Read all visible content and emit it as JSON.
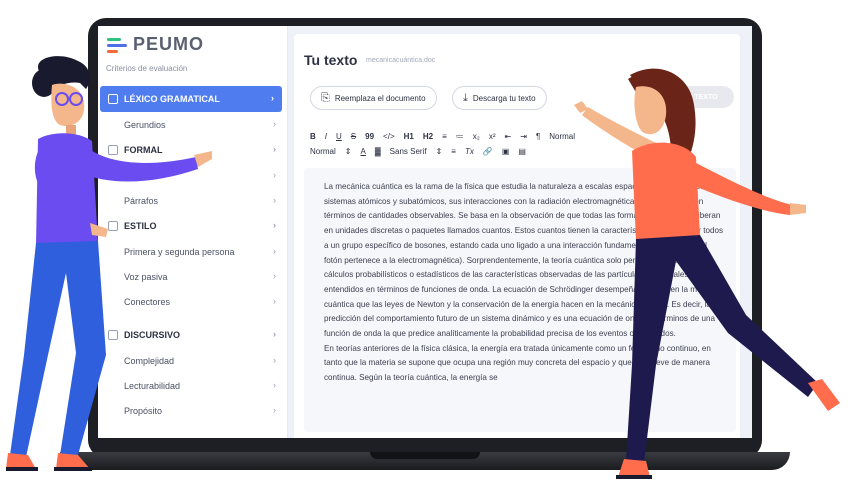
{
  "brand": {
    "name": "PEUMO"
  },
  "sidebar": {
    "header": "Criterios de evaluación",
    "sections": [
      {
        "label": "LÉXICO GRAMATICAL",
        "active": true
      },
      {
        "label": "FORMAL"
      },
      {
        "label": "ESTILO"
      },
      {
        "label": "DISCURSIVO"
      }
    ],
    "sub_lexico": [
      "Gerundios"
    ],
    "sub_formal": [
      "Párrafos"
    ],
    "sub_estilo": [
      "Primera y segunda persona",
      "Voz pasiva",
      "Conectores"
    ],
    "sub_discursivo": [
      "Complejidad",
      "Lecturabilidad",
      "Propósito"
    ]
  },
  "document": {
    "title": "Tu texto",
    "filename": "mecanicacuántica.doc",
    "replace_button": "Reemplaza el documento",
    "download_button": "Descarga tu texto",
    "analyze_button": "TEXTO"
  },
  "toolbar": {
    "row1": [
      "B",
      "I",
      "U",
      "S",
      "99",
      "</>",
      "H1",
      "H2",
      "≡",
      "≔",
      "x₂",
      "x²",
      "⇤",
      "⇥",
      "¶",
      "Normal"
    ],
    "row2": [
      "Normal",
      "⇕",
      "A",
      "▓",
      "Sans Serif",
      "⇕",
      "≡",
      "Tx",
      "🔗",
      "▣",
      "▤"
    ]
  },
  "body_paragraphs": [
    "La mecánica cuántica es la rama de la física que estudia la naturaleza a escalas espaciales pequeñas. Los sistemas atómicos y subatómicos, sus interacciones con la radiación electromagnética y otras fuerzas, en términos de cantidades observables. Se basa en la observación de que todas las formas de energía se liberan en unidades discretas o paquetes llamados cuantos. Estos cuantos tienen la característica de pertenecer todos a un grupo específico de bosones, estando cada uno ligado a una interacción fundamental (por ejemplo, el fotón pertenece a la electromagnética). Sorprendentemente, la teoría cuántica solo permite normalmente cálculos probabilísticos o estadísticos de las características observadas de las partículas elementales, entendidos en términos de funciones de onda. La ecuación de Schrödinger desempeña el papel en la mecánica cuántica que las leyes de Newton y la conservación de la energía hacen en la mecánica clásica. Es decir, la predicción del comportamiento futuro de un sistema dinámico y es una ecuación de onda en términos de una función de onda la que predice analíticamente la probabilidad precisa de los eventos o resultados.",
    "En teorías anteriores de la física clásica, la energía era tratada únicamente como un fenómeno continuo, en tanto que la materia se supone que ocupa una región muy concreta del espacio y que se mueve de manera continua. Según la teoría cuántica, la energía se"
  ],
  "colors": {
    "accent": "#4f7df0",
    "sidebar_active_text": "#ffffff",
    "person_purple": "#6a4cf0",
    "person_orange": "#ff6d4d",
    "jeans": "#2f5fdc",
    "dark_pants": "#1e1a4d"
  }
}
